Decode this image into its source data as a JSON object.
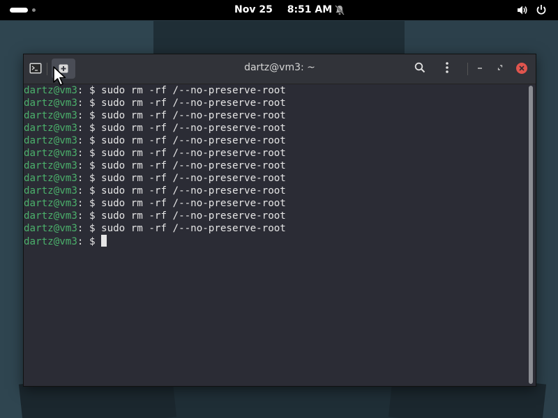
{
  "topbar": {
    "date": "Nov 25",
    "time": "8:51 AM"
  },
  "window": {
    "title": "dartz@vm3: ~"
  },
  "terminal": {
    "prompt_user": "dartz@vm3",
    "prompt_path": ":",
    "prompt_suffix": " $ ",
    "lines": [
      {
        "user": "dartz@vm3",
        "rest": ": $ sudo rm -rf /--no-preserve-root"
      },
      {
        "user": "dartz@vm3",
        "rest": ": $ sudo rm -rf /--no-preserve-root"
      },
      {
        "user": "dartz@vm3",
        "rest": ": $ sudo rm -rf /--no-preserve-root"
      },
      {
        "user": "dartz@vm3",
        "rest": ": $ sudo rm -rf /--no-preserve-root"
      },
      {
        "user": "dartz@vm3",
        "rest": ": $ sudo rm -rf /--no-preserve-root"
      },
      {
        "user": "dartz@vm3",
        "rest": ": $ sudo rm -rf /--no-preserve-root"
      },
      {
        "user": "dartz@vm3",
        "rest": ": $ sudo rm -rf /--no-preserve-root"
      },
      {
        "user": "dartz@vm3",
        "rest": ": $ sudo rm -rf /--no-preserve-root"
      },
      {
        "user": "dartz@vm3",
        "rest": ": $ sudo rm -rf /--no-preserve-root"
      },
      {
        "user": "dartz@vm3",
        "rest": ": $ sudo rm -rf /--no-preserve-root"
      },
      {
        "user": "dartz@vm3",
        "rest": ": $ sudo rm -rf /--no-preserve-root"
      },
      {
        "user": "dartz@vm3",
        "rest": ": $ sudo rm -rf /--no-preserve-root"
      }
    ],
    "current_prompt": {
      "user": "dartz@vm3",
      "rest": ": $ "
    }
  },
  "colors": {
    "prompt_user": "#4bb06b",
    "close_button": "#e0554e",
    "terminal_bg": "#2b2c35"
  },
  "icons": {
    "terminal": "terminal-icon",
    "new_tab": "new-tab-icon",
    "search": "search-icon",
    "menu": "kebab-menu-icon",
    "minimize": "minimize-icon",
    "maximize": "maximize-icon",
    "close": "close-icon",
    "notifications": "bell-off-icon",
    "volume": "volume-icon",
    "power": "power-icon"
  }
}
